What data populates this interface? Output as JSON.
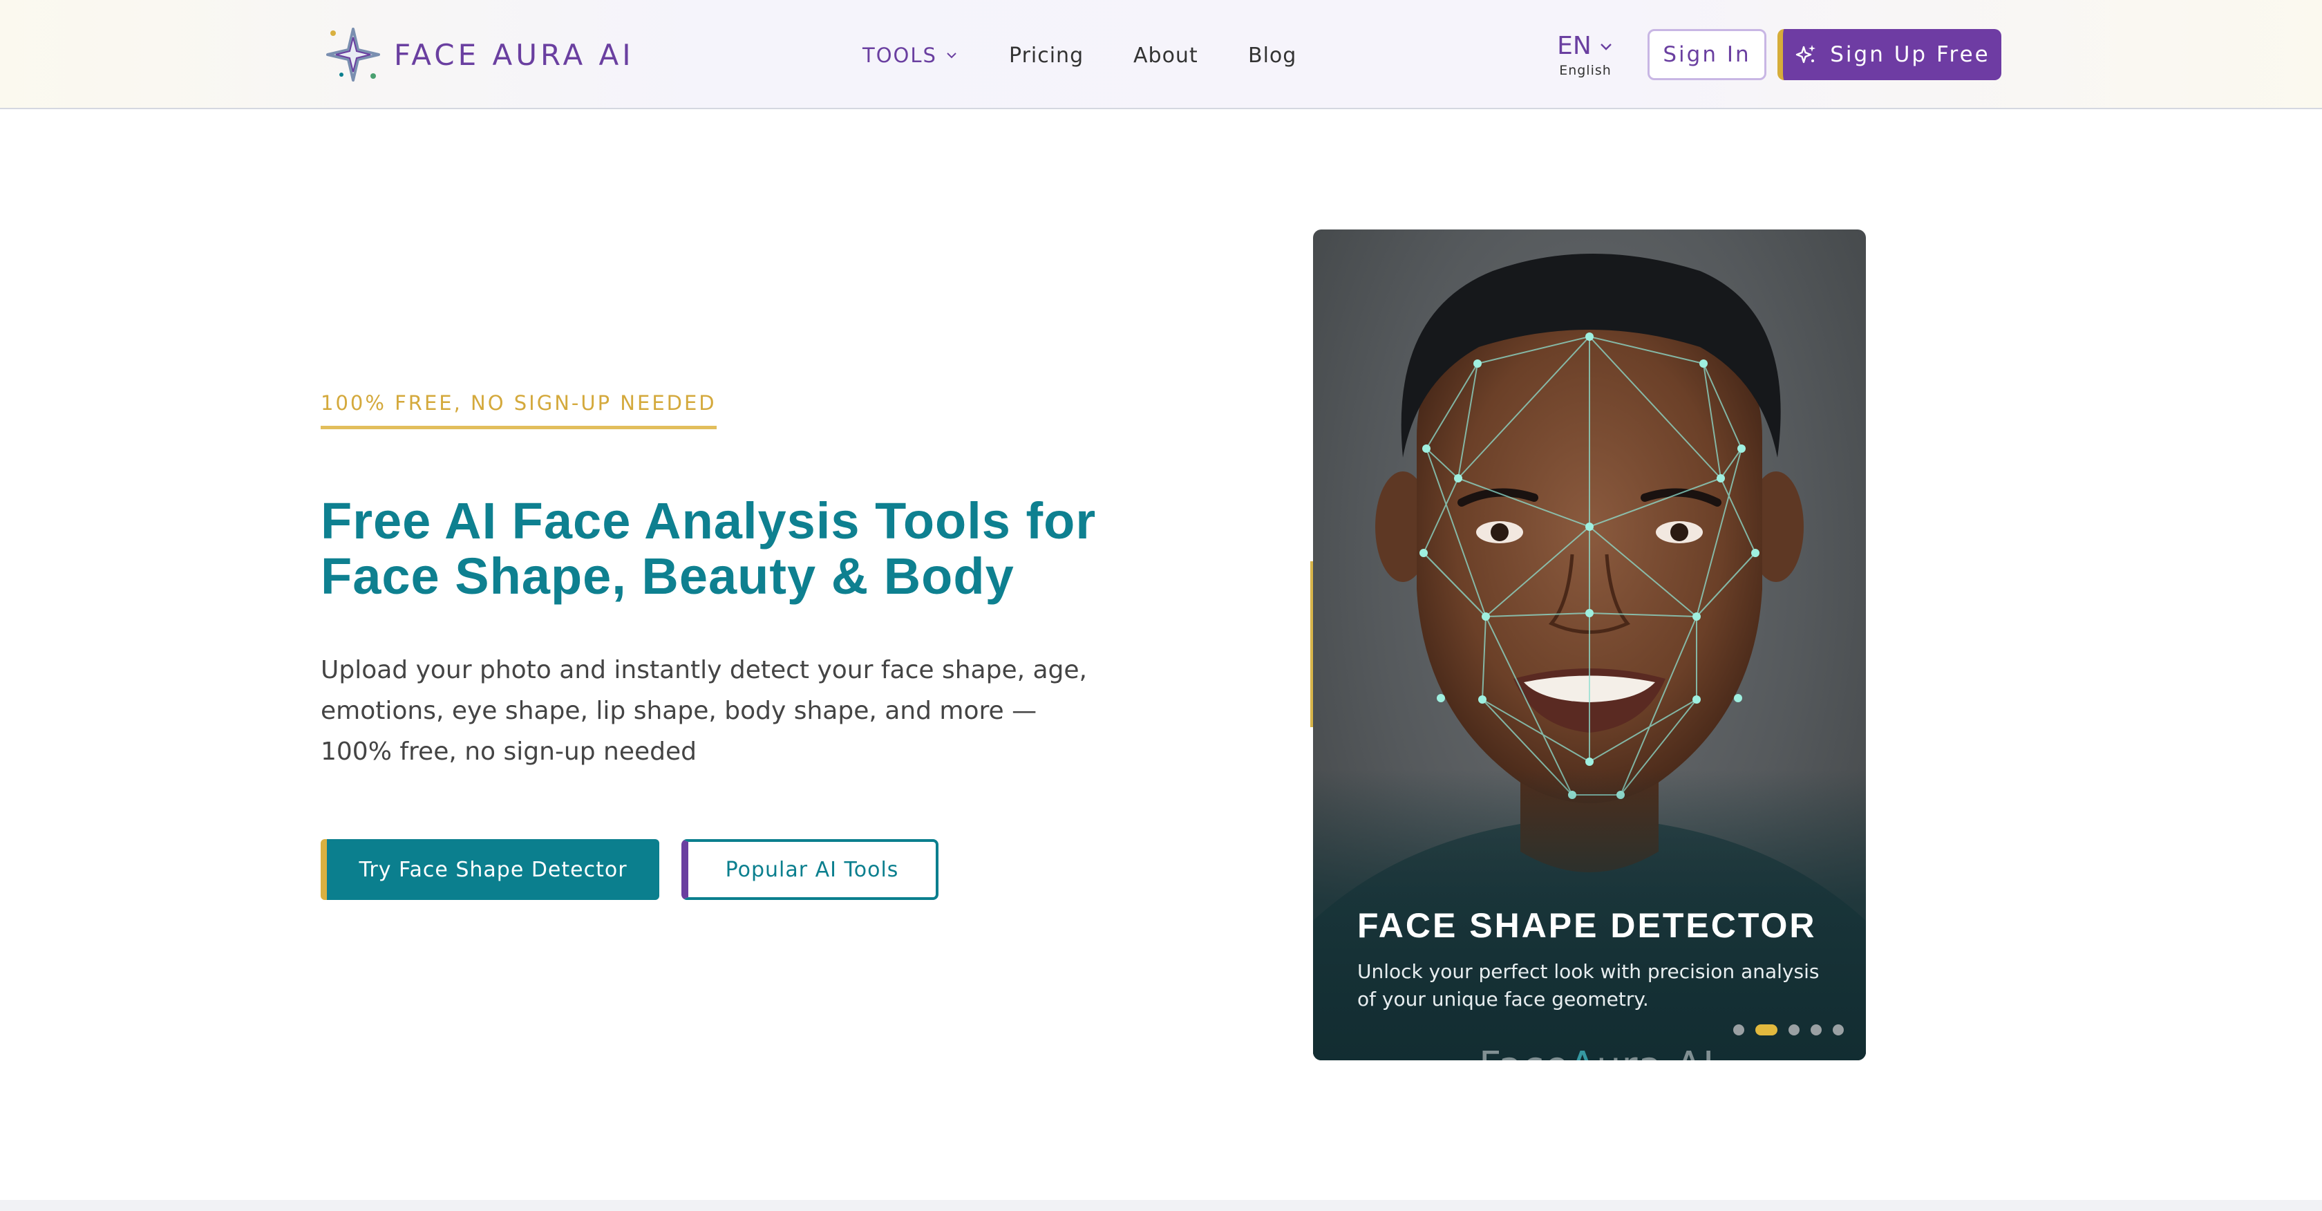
{
  "header": {
    "logo_text": "FACE AURA AI",
    "nav": {
      "tools_label": "TOOLS",
      "pricing_label": "Pricing",
      "about_label": "About",
      "blog_label": "Blog"
    },
    "language": {
      "code": "EN",
      "name": "English"
    },
    "sign_in_label": "Sign In",
    "sign_up_label": "Sign Up Free"
  },
  "hero": {
    "eyebrow": "100% FREE, NO SIGN-UP NEEDED",
    "title_line1": "Free AI Face Analysis Tools for",
    "title_line2": "Face Shape, Beauty & Body",
    "subtitle": "Upload your photo and instantly detect your face shape, age, emotions, eye shape, lip shape, body shape, and more — 100% free, no sign-up needed",
    "primary_cta": "Try Face Shape Detector",
    "secondary_cta": "Popular AI Tools"
  },
  "carousel": {
    "slide_title": "FACE SHAPE DETECTOR",
    "slide_desc": "Unlock your perfect look with precision analysis of your unique face geometry.",
    "watermark_pre": "Face",
    "watermark_a": "A",
    "watermark_post": "ura AI",
    "total_slides": 5,
    "active_slide": 2
  },
  "colors": {
    "brand_purple": "#6a3fa0",
    "brand_teal": "#0b7f8e",
    "accent_gold": "#d9b040"
  },
  "icons": [
    "logo-star-icon",
    "chevron-down-icon",
    "sparkles-icon"
  ]
}
